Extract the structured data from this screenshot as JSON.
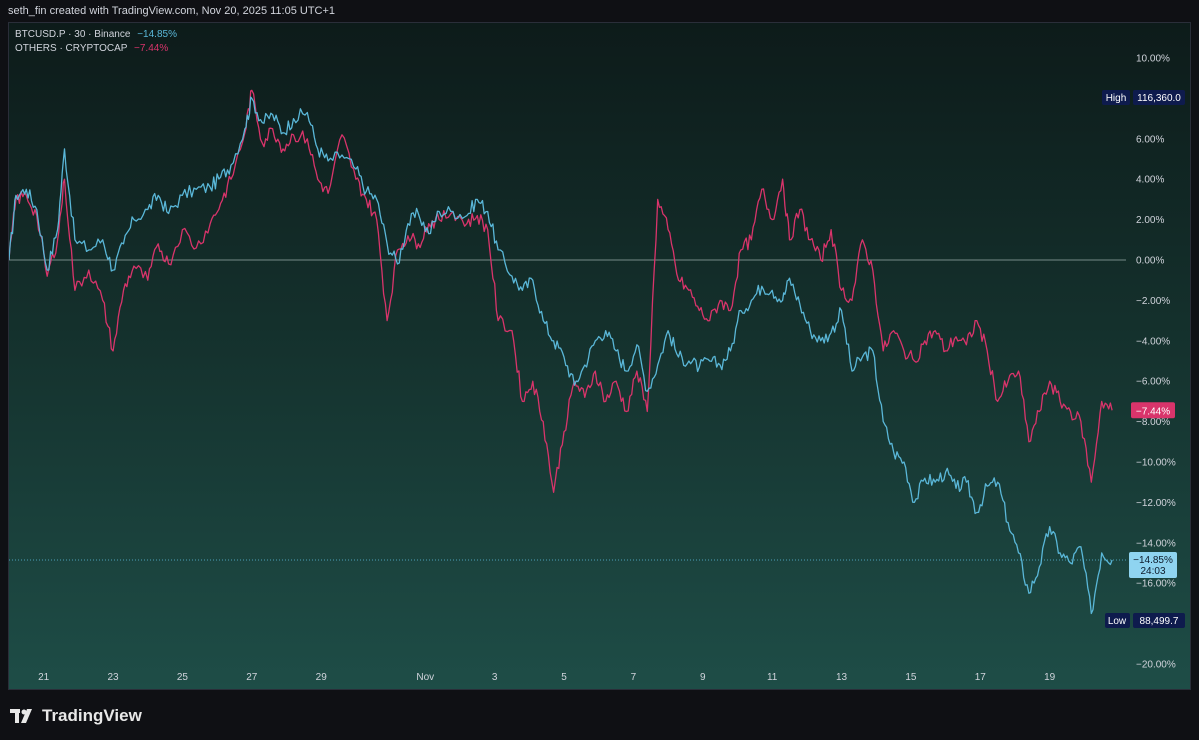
{
  "header": {
    "attribution": "seth_fin created with TradingView.com, Nov 20, 2025 11:05 UTC+1"
  },
  "legend": {
    "btc": {
      "label": "BTCUSD.P · 30 · Binance",
      "change": "−14.85%"
    },
    "others": {
      "label": "OTHERS · CRYPTOCAP",
      "change": "−7.44%"
    }
  },
  "high_label": {
    "tag": "High",
    "value": "116,360.0"
  },
  "low_label": {
    "tag": "Low",
    "value": "88,499.7"
  },
  "last_tags": {
    "others": "−7.44%",
    "btc_pct": "−14.85%",
    "btc_countdown": "24:03"
  },
  "footer": {
    "brand": "TradingView"
  },
  "colors": {
    "btc": "#5ab7d8",
    "others": "#d9346b",
    "high_low_bg": "#0e1b4d",
    "zero_line": "#9fb3b0"
  },
  "chart_data": {
    "type": "line",
    "title": "",
    "y_unit": "%",
    "ylim": [
      -20,
      10
    ],
    "yticks": [
      10,
      6,
      4,
      2,
      0,
      -2,
      -4,
      -6,
      -8,
      -10,
      -12,
      -14,
      -16,
      -20
    ],
    "ytick_labels": [
      "10.00%",
      "6.00%",
      "4.00%",
      "2.00%",
      "0.00%",
      "−2.00%",
      "−4.00%",
      "−6.00%",
      "−8.00%",
      "−10.00%",
      "−12.00%",
      "−14.00%",
      "−16.00%",
      "−20.00%"
    ],
    "x_tick_labels": [
      "21",
      "23",
      "25",
      "27",
      "29",
      "Nov",
      "3",
      "5",
      "7",
      "9",
      "11",
      "13",
      "15",
      "17",
      "19"
    ],
    "x_tick_days": [
      1,
      3,
      5,
      7,
      9,
      12,
      14,
      16,
      18,
      20,
      22,
      24,
      26,
      28,
      30
    ],
    "series": [
      {
        "name": "BTCUSD.P",
        "color": "#5ab7d8",
        "points": [
          [
            0.0,
            0.0
          ],
          [
            0.2,
            3.2
          ],
          [
            0.5,
            3.5
          ],
          [
            0.8,
            2.5
          ],
          [
            1.1,
            -0.5
          ],
          [
            1.4,
            1.5
          ],
          [
            1.6,
            5.5
          ],
          [
            1.9,
            1.0
          ],
          [
            2.3,
            0.5
          ],
          [
            2.7,
            1.0
          ],
          [
            3.0,
            -0.5
          ],
          [
            3.3,
            0.8
          ],
          [
            3.6,
            2.0
          ],
          [
            4.0,
            2.5
          ],
          [
            4.3,
            3.2
          ],
          [
            4.6,
            2.3
          ],
          [
            5.0,
            3.2
          ],
          [
            5.4,
            3.5
          ],
          [
            5.8,
            3.6
          ],
          [
            6.1,
            4.1
          ],
          [
            6.4,
            4.7
          ],
          [
            6.8,
            6.5
          ],
          [
            7.0,
            8.0
          ],
          [
            7.3,
            6.8
          ],
          [
            7.6,
            7.2
          ],
          [
            7.9,
            6.3
          ],
          [
            8.2,
            7.0
          ],
          [
            8.6,
            7.3
          ],
          [
            8.9,
            5.5
          ],
          [
            9.2,
            4.9
          ],
          [
            9.6,
            5.2
          ],
          [
            10.0,
            4.5
          ],
          [
            10.3,
            3.4
          ],
          [
            10.6,
            3.0
          ],
          [
            10.9,
            0.8
          ],
          [
            11.2,
            -0.2
          ],
          [
            11.5,
            1.8
          ],
          [
            11.8,
            2.3
          ],
          [
            12.1,
            1.3
          ],
          [
            12.4,
            2.4
          ],
          [
            12.8,
            2.4
          ],
          [
            13.2,
            2.2
          ],
          [
            13.5,
            3.0
          ],
          [
            13.8,
            2.4
          ],
          [
            14.1,
            0.5
          ],
          [
            14.5,
            -0.8
          ],
          [
            14.8,
            -1.5
          ],
          [
            15.1,
            -1.0
          ],
          [
            15.4,
            -3.0
          ],
          [
            15.7,
            -4.0
          ],
          [
            16.0,
            -4.8
          ],
          [
            16.3,
            -6.2
          ],
          [
            16.6,
            -5.2
          ],
          [
            16.9,
            -4.0
          ],
          [
            17.2,
            -3.5
          ],
          [
            17.5,
            -4.5
          ],
          [
            17.8,
            -5.5
          ],
          [
            18.1,
            -4.2
          ],
          [
            18.4,
            -6.5
          ],
          [
            18.7,
            -5.2
          ],
          [
            19.0,
            -3.5
          ],
          [
            19.3,
            -4.8
          ],
          [
            19.6,
            -5.0
          ],
          [
            19.9,
            -5.3
          ],
          [
            20.2,
            -5.0
          ],
          [
            20.5,
            -5.2
          ],
          [
            20.8,
            -4.5
          ],
          [
            21.1,
            -2.5
          ],
          [
            21.4,
            -2.0
          ],
          [
            21.7,
            -1.3
          ],
          [
            22.0,
            -1.5
          ],
          [
            22.3,
            -2.0
          ],
          [
            22.5,
            -0.9
          ],
          [
            22.8,
            -2.2
          ],
          [
            23.1,
            -3.5
          ],
          [
            23.4,
            -4.0
          ],
          [
            23.7,
            -3.6
          ],
          [
            24.0,
            -2.5
          ],
          [
            24.3,
            -5.5
          ],
          [
            24.6,
            -4.8
          ],
          [
            24.9,
            -4.5
          ],
          [
            25.2,
            -8.0
          ],
          [
            25.5,
            -9.5
          ],
          [
            25.8,
            -10.0
          ],
          [
            26.1,
            -12.0
          ],
          [
            26.4,
            -10.8
          ],
          [
            26.7,
            -11.0
          ],
          [
            27.0,
            -10.5
          ],
          [
            27.3,
            -11.3
          ],
          [
            27.6,
            -11.0
          ],
          [
            27.9,
            -12.5
          ],
          [
            28.2,
            -11.2
          ],
          [
            28.5,
            -11.0
          ],
          [
            28.8,
            -13.0
          ],
          [
            29.1,
            -14.5
          ],
          [
            29.4,
            -16.5
          ],
          [
            29.7,
            -15.2
          ],
          [
            30.0,
            -13.2
          ],
          [
            30.3,
            -14.5
          ],
          [
            30.6,
            -15.0
          ],
          [
            30.9,
            -14.2
          ],
          [
            31.2,
            -17.5
          ],
          [
            31.5,
            -14.5
          ],
          [
            31.8,
            -14.85
          ]
        ]
      },
      {
        "name": "OTHERS",
        "color": "#d9346b",
        "points": [
          [
            0.0,
            0.0
          ],
          [
            0.2,
            3.0
          ],
          [
            0.5,
            3.2
          ],
          [
            0.8,
            2.2
          ],
          [
            1.1,
            -0.8
          ],
          [
            1.4,
            1.0
          ],
          [
            1.6,
            4.0
          ],
          [
            1.9,
            -1.5
          ],
          [
            2.3,
            -0.5
          ],
          [
            2.7,
            -2.0
          ],
          [
            3.0,
            -4.5
          ],
          [
            3.3,
            -1.5
          ],
          [
            3.6,
            -0.3
          ],
          [
            4.0,
            -1.0
          ],
          [
            4.3,
            0.8
          ],
          [
            4.6,
            -0.2
          ],
          [
            5.0,
            1.5
          ],
          [
            5.4,
            0.6
          ],
          [
            5.8,
            1.8
          ],
          [
            6.1,
            2.8
          ],
          [
            6.4,
            4.0
          ],
          [
            6.8,
            6.3
          ],
          [
            7.0,
            8.4
          ],
          [
            7.3,
            5.8
          ],
          [
            7.6,
            6.5
          ],
          [
            7.9,
            5.5
          ],
          [
            8.2,
            6.2
          ],
          [
            8.6,
            6.0
          ],
          [
            8.9,
            4.0
          ],
          [
            9.2,
            3.3
          ],
          [
            9.6,
            6.2
          ],
          [
            10.0,
            4.0
          ],
          [
            10.3,
            3.0
          ],
          [
            10.6,
            2.0
          ],
          [
            10.9,
            -3.0
          ],
          [
            11.2,
            0.5
          ],
          [
            11.5,
            1.2
          ],
          [
            11.8,
            0.8
          ],
          [
            12.1,
            1.8
          ],
          [
            12.4,
            2.0
          ],
          [
            12.8,
            2.4
          ],
          [
            13.2,
            1.8
          ],
          [
            13.5,
            2.2
          ],
          [
            13.8,
            1.5
          ],
          [
            14.1,
            -3.0
          ],
          [
            14.5,
            -3.5
          ],
          [
            14.8,
            -7.0
          ],
          [
            15.1,
            -6.0
          ],
          [
            15.4,
            -8.0
          ],
          [
            15.7,
            -11.5
          ],
          [
            16.0,
            -8.5
          ],
          [
            16.3,
            -6.0
          ],
          [
            16.6,
            -6.8
          ],
          [
            16.9,
            -5.5
          ],
          [
            17.2,
            -7.0
          ],
          [
            17.5,
            -6.0
          ],
          [
            17.8,
            -7.5
          ],
          [
            18.1,
            -5.5
          ],
          [
            18.4,
            -7.5
          ],
          [
            18.7,
            3.0
          ],
          [
            19.0,
            1.5
          ],
          [
            19.3,
            -1.0
          ],
          [
            19.6,
            -1.5
          ],
          [
            19.9,
            -2.5
          ],
          [
            20.2,
            -3.0
          ],
          [
            20.5,
            -2.0
          ],
          [
            20.8,
            -2.5
          ],
          [
            21.1,
            0.5
          ],
          [
            21.4,
            1.0
          ],
          [
            21.7,
            3.5
          ],
          [
            22.0,
            2.0
          ],
          [
            22.3,
            4.0
          ],
          [
            22.5,
            1.0
          ],
          [
            22.8,
            2.5
          ],
          [
            23.1,
            1.0
          ],
          [
            23.4,
            0.0
          ],
          [
            23.7,
            1.5
          ],
          [
            24.0,
            -1.5
          ],
          [
            24.3,
            -2.0
          ],
          [
            24.6,
            1.0
          ],
          [
            24.9,
            -0.5
          ],
          [
            25.2,
            -4.5
          ],
          [
            25.5,
            -3.5
          ],
          [
            25.8,
            -4.5
          ],
          [
            26.1,
            -5.0
          ],
          [
            26.4,
            -4.0
          ],
          [
            26.7,
            -3.5
          ],
          [
            27.0,
            -4.5
          ],
          [
            27.3,
            -3.8
          ],
          [
            27.6,
            -4.2
          ],
          [
            27.9,
            -3.0
          ],
          [
            28.2,
            -4.5
          ],
          [
            28.5,
            -7.0
          ],
          [
            28.8,
            -6.0
          ],
          [
            29.1,
            -5.5
          ],
          [
            29.4,
            -9.0
          ],
          [
            29.7,
            -7.5
          ],
          [
            30.0,
            -6.0
          ],
          [
            30.3,
            -7.0
          ],
          [
            30.6,
            -7.5
          ],
          [
            30.9,
            -8.0
          ],
          [
            31.2,
            -11.0
          ],
          [
            31.5,
            -7.0
          ],
          [
            31.8,
            -7.44
          ]
        ]
      }
    ],
    "last_values": {
      "BTCUSD.P": -14.85,
      "OTHERS": -7.44
    },
    "high_value": 116360.0,
    "low_value": 88499.7,
    "grid": false,
    "legend_position": "top-left"
  }
}
